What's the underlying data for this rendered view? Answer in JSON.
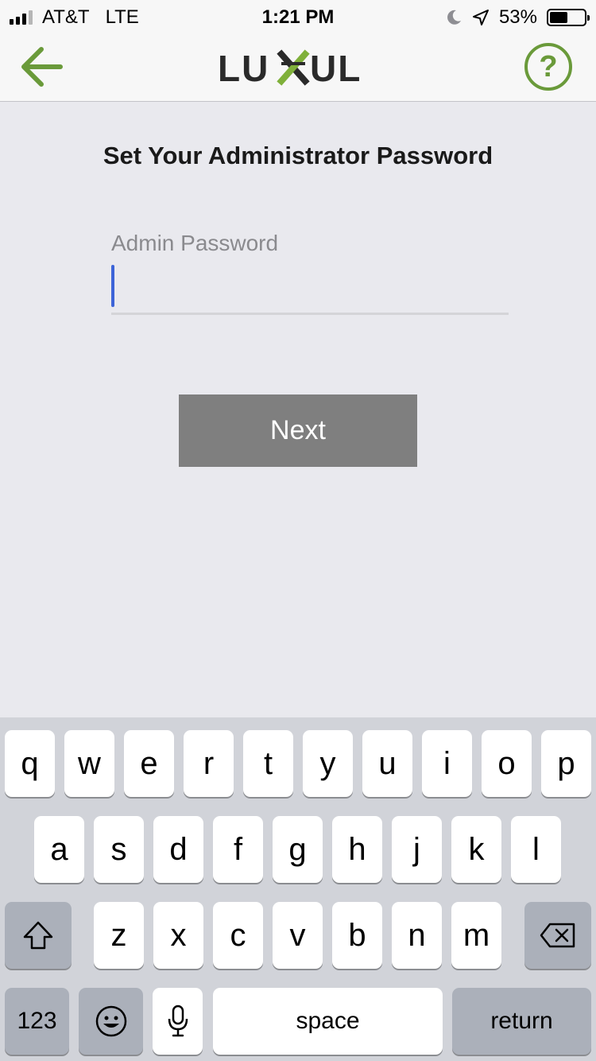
{
  "status_bar": {
    "carrier": "AT&T",
    "network": "LTE",
    "time": "1:21 PM",
    "battery_percent": "53%",
    "battery_level": 0.53,
    "signal_bars": 3,
    "icons": [
      "moon-icon",
      "location-arrow-icon",
      "battery-icon"
    ]
  },
  "nav": {
    "back_icon": "back-arrow-icon",
    "logo_text": "LUXUL",
    "help_label": "?",
    "accent_color": "#6a9a3a"
  },
  "form": {
    "title": "Set Your Administrator Password",
    "password_label": "Admin Password",
    "password_value": "",
    "next_label": "Next"
  },
  "keyboard": {
    "row1": [
      "q",
      "w",
      "e",
      "r",
      "t",
      "y",
      "u",
      "i",
      "o",
      "p"
    ],
    "row2": [
      "a",
      "s",
      "d",
      "f",
      "g",
      "h",
      "j",
      "k",
      "l"
    ],
    "row3": [
      "z",
      "x",
      "c",
      "v",
      "b",
      "n",
      "m"
    ],
    "numbers_label": "123",
    "space_label": "space",
    "return_label": "return",
    "shift_icon": "shift-icon",
    "delete_icon": "delete-icon",
    "emoji_icon": "emoji-icon",
    "mic_icon": "microphone-icon"
  }
}
